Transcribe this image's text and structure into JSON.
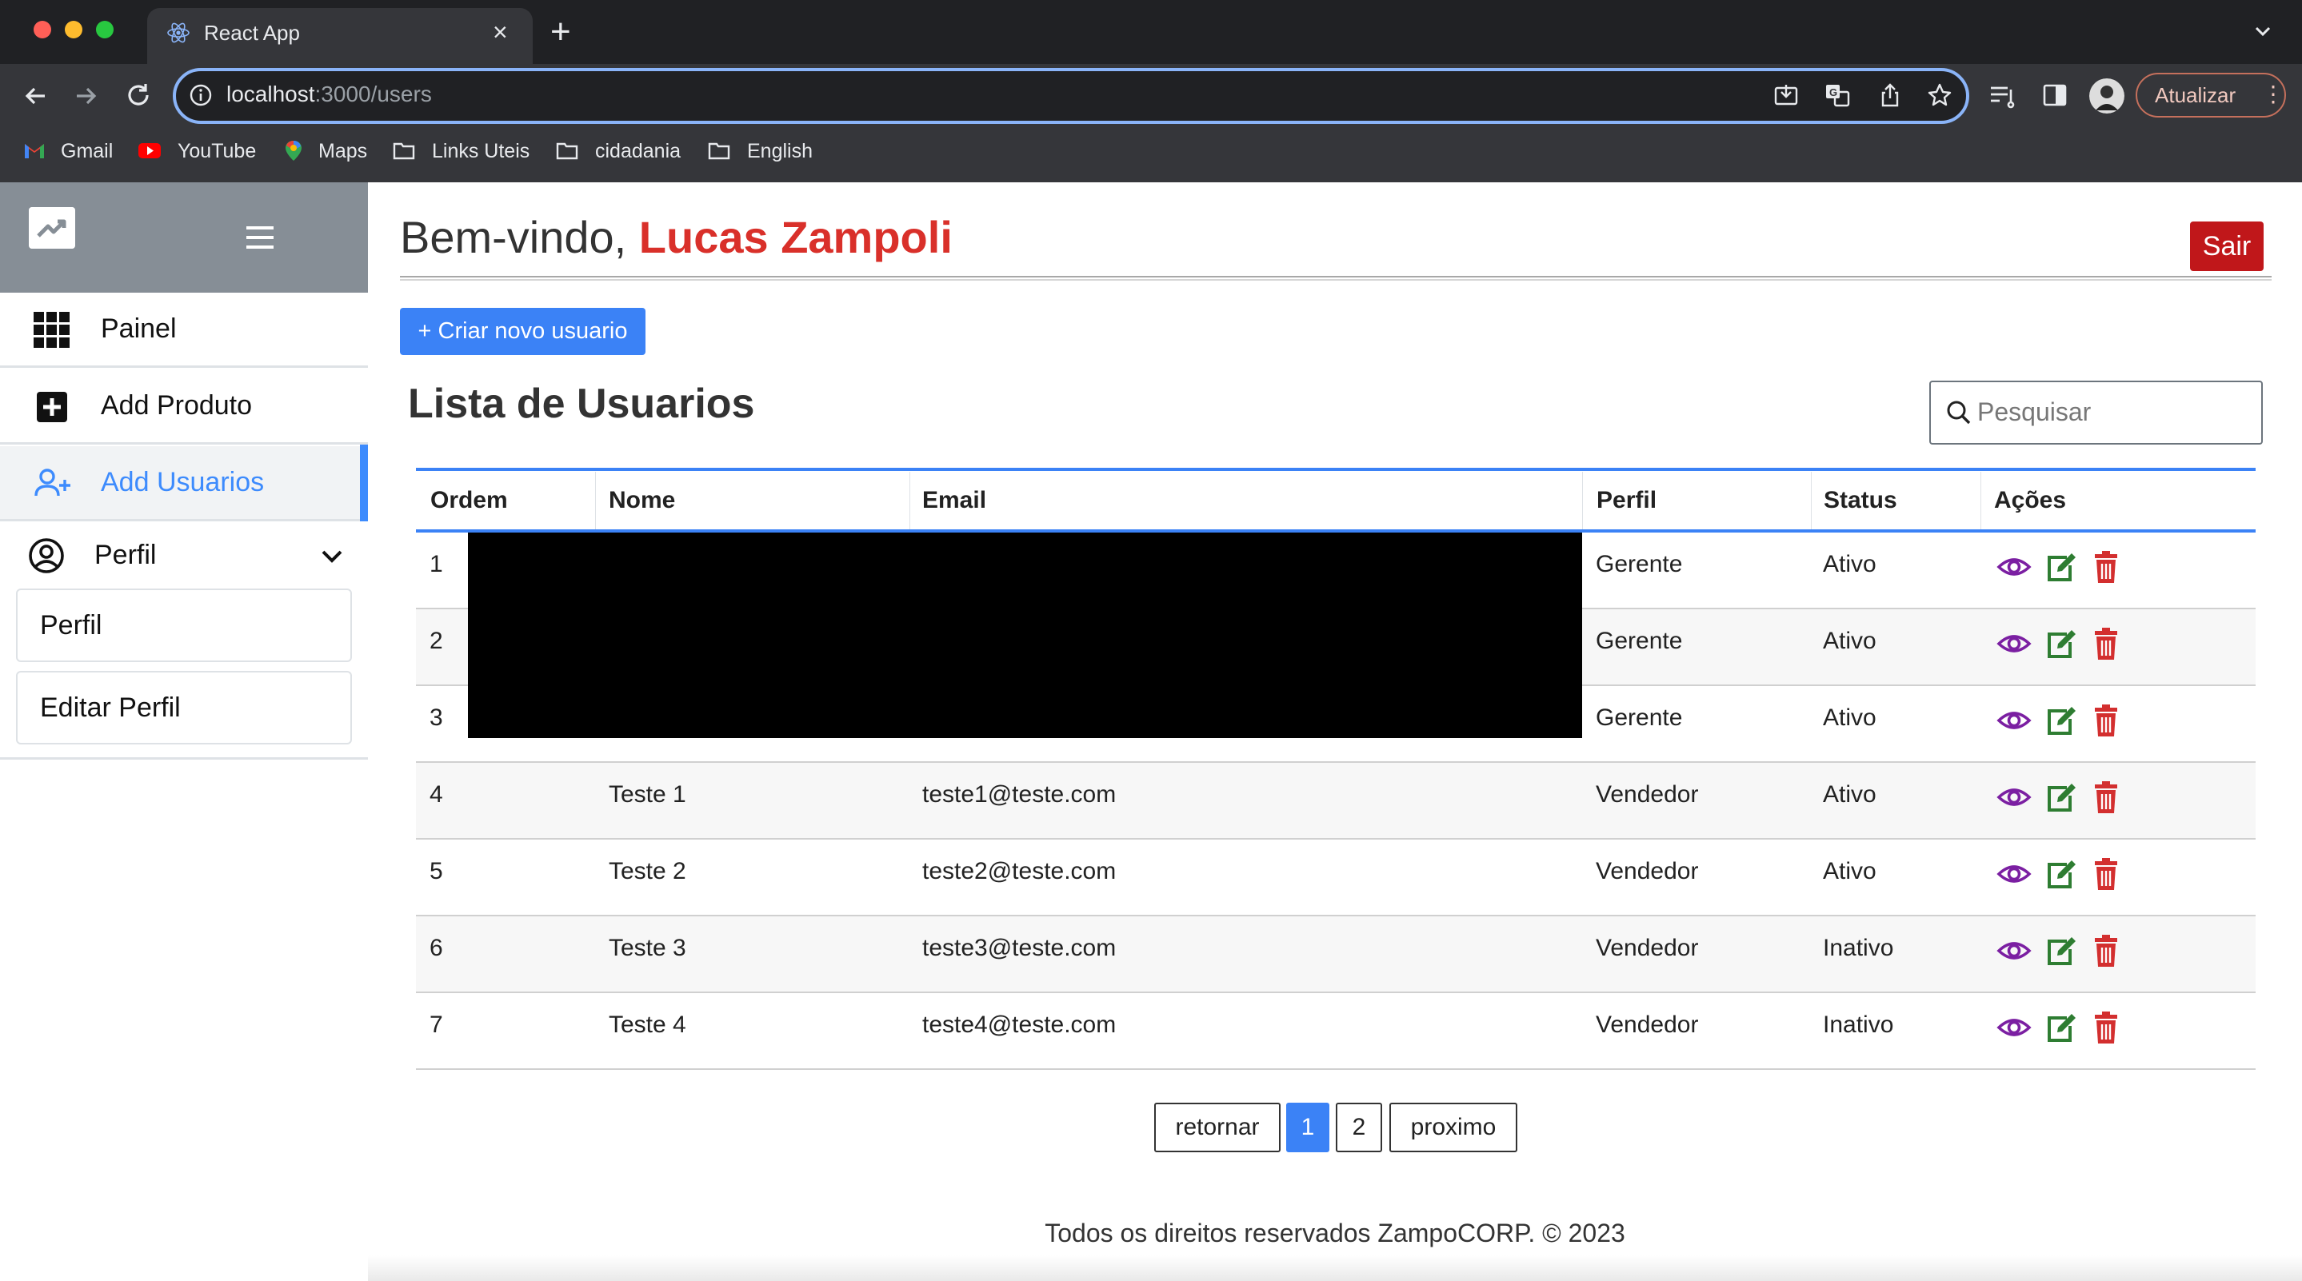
{
  "browser": {
    "tab_title": "React App",
    "url_host": "localhost",
    "url_path": ":3000/users",
    "update_label": "Atualizar",
    "bookmarks": [
      "Gmail",
      "YouTube",
      "Maps",
      "Links Uteis",
      "cidadania",
      "English"
    ]
  },
  "header": {
    "welcome_prefix": "Bem-vindo, ",
    "user_name": "Lucas Zampoli",
    "logout_label": "Sair"
  },
  "sidebar": {
    "items": [
      {
        "label": "Painel",
        "icon": "grid-icon"
      },
      {
        "label": "Add Produto",
        "icon": "plus-square-icon"
      },
      {
        "label": "Add Usuarios",
        "icon": "user-plus-icon",
        "active": true
      },
      {
        "label": "Perfil",
        "icon": "user-circle-icon"
      }
    ],
    "perfil_sub": [
      "Perfil",
      "Editar Perfil"
    ]
  },
  "main": {
    "create_button": "+ Criar novo usuario",
    "list_title": "Lista de Usuarios",
    "search_placeholder": "Pesquisar",
    "columns": [
      "Ordem",
      "Nome",
      "Email",
      "Perfil",
      "Status",
      "Ações"
    ],
    "rows": [
      {
        "ordem": "1",
        "nome": "",
        "email": "",
        "perfil": "Gerente",
        "status": "Ativo"
      },
      {
        "ordem": "2",
        "nome": "",
        "email": "",
        "perfil": "Gerente",
        "status": "Ativo"
      },
      {
        "ordem": "3",
        "nome": "",
        "email": "",
        "perfil": "Gerente",
        "status": "Ativo"
      },
      {
        "ordem": "4",
        "nome": "Teste 1",
        "email": "teste1@teste.com",
        "perfil": "Vendedor",
        "status": "Ativo"
      },
      {
        "ordem": "5",
        "nome": "Teste 2",
        "email": "teste2@teste.com",
        "perfil": "Vendedor",
        "status": "Ativo"
      },
      {
        "ordem": "6",
        "nome": "Teste 3",
        "email": "teste3@teste.com",
        "perfil": "Vendedor",
        "status": "Inativo"
      },
      {
        "ordem": "7",
        "nome": "Teste 4",
        "email": "teste4@teste.com",
        "perfil": "Vendedor",
        "status": "Inativo"
      }
    ],
    "pagination": {
      "prev": "retornar",
      "pages": [
        "1",
        "2"
      ],
      "next": "proximo",
      "current": "1"
    }
  },
  "footer": "Todos os direitos reservados ZampoCORP. © 2023",
  "colors": {
    "accent": "#3b82f6",
    "danger": "#c0171a",
    "name": "#d9302a",
    "view": "#7b1fa2",
    "edit": "#2e7d32",
    "delete": "#d32f2f"
  }
}
